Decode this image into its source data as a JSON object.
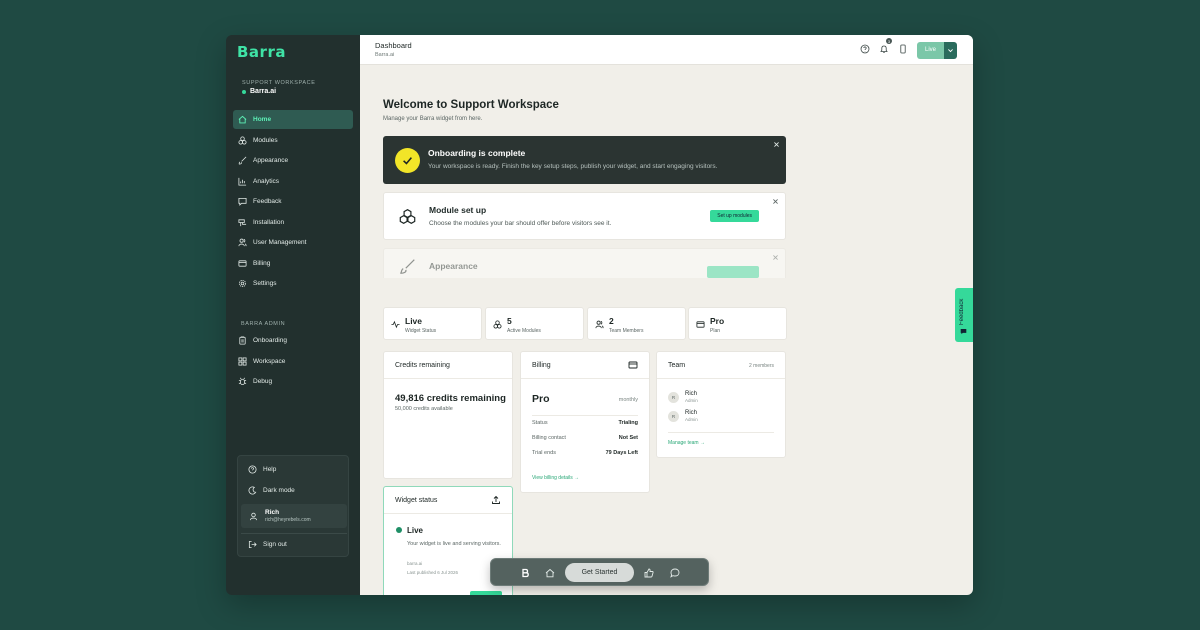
{
  "colors": {
    "accent": "#35d99a",
    "sidebar_bg": "#22302e",
    "page_bg": "#1f4a43",
    "main_bg": "#f1efe9"
  },
  "sidebar": {
    "logo": "Barra",
    "workspace_label": "SUPPORT WORKSPACE",
    "workspace_name": "Barra.ai",
    "items": [
      {
        "label": "Home",
        "icon": "home-icon",
        "active": true
      },
      {
        "label": "Modules",
        "icon": "modules-icon"
      },
      {
        "label": "Appearance",
        "icon": "brush-icon"
      },
      {
        "label": "Analytics",
        "icon": "chart-icon"
      },
      {
        "label": "Feedback",
        "icon": "chat-icon"
      },
      {
        "label": "Installation",
        "icon": "install-icon"
      },
      {
        "label": "User Management",
        "icon": "users-icon"
      },
      {
        "label": "Billing",
        "icon": "card-icon"
      },
      {
        "label": "Settings",
        "icon": "gear-icon"
      }
    ],
    "admin_label": "BARRA ADMIN",
    "admin_items": [
      {
        "label": "Onboarding",
        "icon": "clipboard-icon"
      },
      {
        "label": "Workspace",
        "icon": "grid-icon"
      },
      {
        "label": "Debug",
        "icon": "bug-icon"
      }
    ],
    "footer": {
      "help": "Help",
      "dark_mode": "Dark mode",
      "user_name": "Rich",
      "user_email": "rich@heyrebels.com",
      "sign_out": "Sign out"
    }
  },
  "topbar": {
    "title": "Dashboard",
    "subtitle": "Barra.ai",
    "notification_count": "3",
    "live_label": "Live"
  },
  "welcome": {
    "title": "Welcome to Support Workspace",
    "subtitle": "Manage your Barra widget from here."
  },
  "banners": {
    "onboarding": {
      "title": "Onboarding is complete",
      "text": "Your workspace is ready. Finish the key setup steps, publish your widget, and start engaging visitors."
    },
    "modules": {
      "title": "Module set up",
      "text": "Choose the modules your bar should offer before visitors see it.",
      "button": "Set up modules"
    },
    "appearance": {
      "title": "Appearance"
    }
  },
  "stats": [
    {
      "value": "Live",
      "label": "Widget Status",
      "icon": "pulse-icon"
    },
    {
      "value": "5",
      "label": "Active Modules",
      "icon": "modules-icon"
    },
    {
      "value": "2",
      "label": "Team Members",
      "icon": "users-icon"
    },
    {
      "value": "Pro",
      "label": "Plan",
      "icon": "card-icon"
    }
  ],
  "credits": {
    "title": "Credits remaining",
    "remaining": "49,816 credits remaining",
    "available": "50,000 credits available"
  },
  "billing": {
    "title": "Billing",
    "plan": "Pro",
    "cycle": "monthly",
    "rows": [
      {
        "label": "Status",
        "value": "Trialing"
      },
      {
        "label": "Billing contact",
        "value": "Not Set"
      },
      {
        "label": "Trial ends",
        "value": "79 Days Left"
      }
    ],
    "link": "View billing details →"
  },
  "team": {
    "title": "Team",
    "count": "2 members",
    "members": [
      {
        "initial": "R",
        "name": "Rich",
        "role": "Admin"
      },
      {
        "initial": "R",
        "name": "Rich",
        "role": "Admin"
      }
    ],
    "link": "Manage team →"
  },
  "widget_status": {
    "title": "Widget status",
    "status": "Live",
    "text": "Your widget is live and serving visitors.",
    "domain": "barra.ai",
    "published": "Last published 6 Jul 2026"
  },
  "dock": {
    "cta": "Get Started"
  },
  "feedback_tab": {
    "label": "Feedback"
  }
}
